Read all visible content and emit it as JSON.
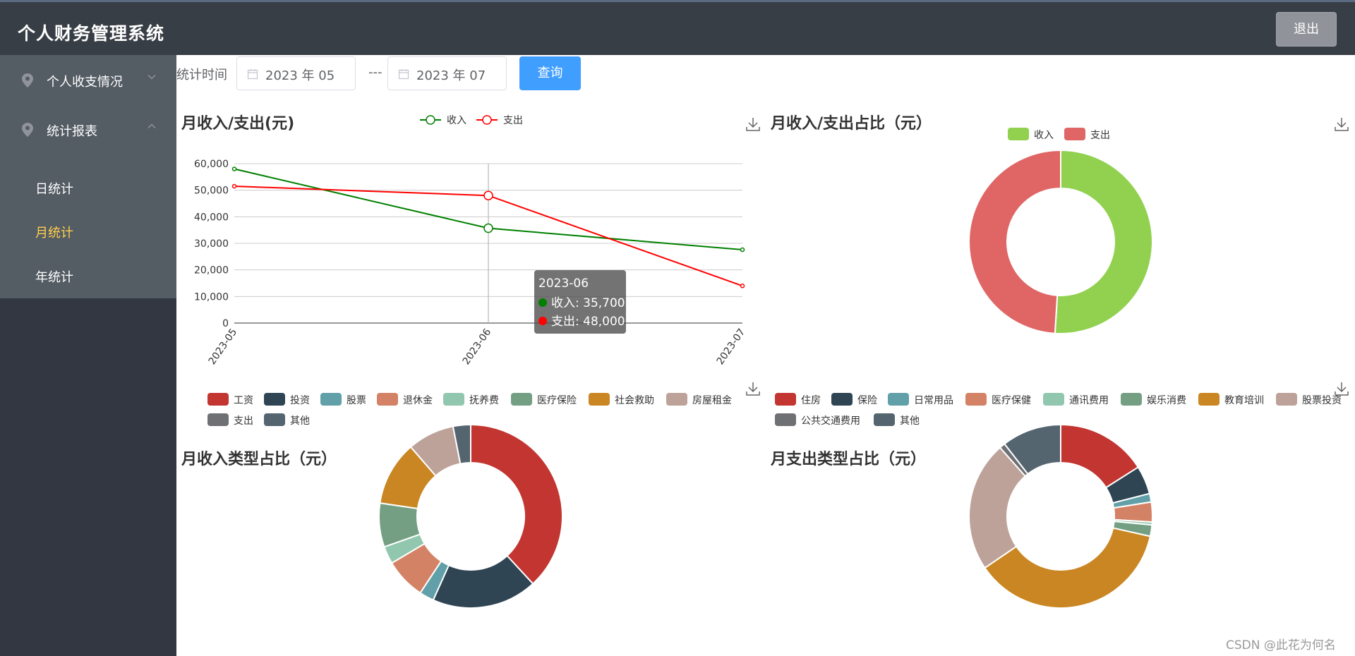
{
  "app": {
    "title": "个人财务管理系统",
    "logout_label": "退出"
  },
  "sidebar": {
    "menus": [
      {
        "label": "个人收支情况",
        "icon": "location-pin-icon"
      },
      {
        "label": "统计报表",
        "icon": "location-pin-icon"
      }
    ],
    "submenu": [
      {
        "label": "日统计",
        "active": false
      },
      {
        "label": "月统计",
        "active": true
      },
      {
        "label": "年统计",
        "active": false
      }
    ],
    "colors": {
      "bg": "#323741",
      "menu_bg": "#545c64",
      "active_text": "#ffd04b"
    }
  },
  "filter": {
    "label": "统计时间",
    "start": "2023 年 05",
    "separator": "---",
    "end": "2023 年 07 ",
    "query_label": "查询"
  },
  "charts": {
    "line_title": "月收入/支出(元)",
    "pie_title": "月收入/支出占比（元）",
    "income_type_title": "月收入类型占比（元）",
    "expense_type_title": "月支出类型占比（元）"
  },
  "tooltip": {
    "title": "2023-06",
    "rows": [
      {
        "label": "收入: 35,700",
        "color": "#008000"
      },
      {
        "label": "支出: 48,000",
        "color": "#ff0000"
      }
    ]
  },
  "chart_data": [
    {
      "type": "line",
      "title": "月收入/支出(元)",
      "x": [
        "2023-05",
        "2023-06",
        "2023-07"
      ],
      "yticks": [
        "0",
        "10,000",
        "20,000",
        "30,000",
        "40,000",
        "50,000",
        "60,000"
      ],
      "ylim": [
        0,
        60000
      ],
      "grid": true,
      "legend": "top-center",
      "series": [
        {
          "name": "收入",
          "color": "#008000",
          "values": [
            58000,
            35700,
            27600
          ]
        },
        {
          "name": "支出",
          "color": "#ff0000",
          "values": [
            51500,
            48000,
            14000
          ]
        }
      ]
    },
    {
      "type": "pie",
      "title": "月收入/支出占比（元）",
      "legend": "top-center",
      "slices": [
        {
          "name": "收入",
          "value": 51,
          "color": "#91d14f"
        },
        {
          "name": "支出",
          "value": 49,
          "color": "#e06666"
        }
      ]
    },
    {
      "type": "pie",
      "title": "月收入类型占比（元）",
      "legend": "top",
      "slices": [
        {
          "name": "工资",
          "value": 37,
          "color": "#c23531"
        },
        {
          "name": "投资",
          "value": 18,
          "color": "#2f4554"
        },
        {
          "name": "股票",
          "value": 2.5,
          "color": "#61a0a8"
        },
        {
          "name": "退休金",
          "value": 7,
          "color": "#d48265"
        },
        {
          "name": "抚养费",
          "value": 3,
          "color": "#91c7ae"
        },
        {
          "name": "医疗保险",
          "value": 7.5,
          "color": "#749f83"
        },
        {
          "name": "社会救助",
          "value": 11,
          "color": "#ca8622"
        },
        {
          "name": "房屋租金",
          "value": 8,
          "color": "#bda29a"
        },
        {
          "name": "支出",
          "value": 0,
          "color": "#6e7074"
        },
        {
          "name": "其他",
          "value": 3,
          "color": "#546570"
        }
      ]
    },
    {
      "type": "pie",
      "title": "月支出类型占比（元）",
      "legend": "top",
      "slices": [
        {
          "name": "住房",
          "value": 16,
          "color": "#c23531"
        },
        {
          "name": "保险",
          "value": 5,
          "color": "#2f4554"
        },
        {
          "name": "日常用品",
          "value": 1.5,
          "color": "#61a0a8"
        },
        {
          "name": "医疗保健",
          "value": 3.5,
          "color": "#d48265"
        },
        {
          "name": "通讯费用",
          "value": 0.5,
          "color": "#91c7ae"
        },
        {
          "name": "娱乐消费",
          "value": 2,
          "color": "#749f83"
        },
        {
          "name": "教育培训",
          "value": 37,
          "color": "#ca8622"
        },
        {
          "name": "股票投资",
          "value": 23,
          "color": "#bda29a"
        },
        {
          "name": "公共交通费用",
          "value": 1,
          "color": "#6e7074"
        },
        {
          "name": "其他",
          "value": 10.5,
          "color": "#546570"
        }
      ]
    }
  ],
  "watermark": "CSDN @此花为何名"
}
